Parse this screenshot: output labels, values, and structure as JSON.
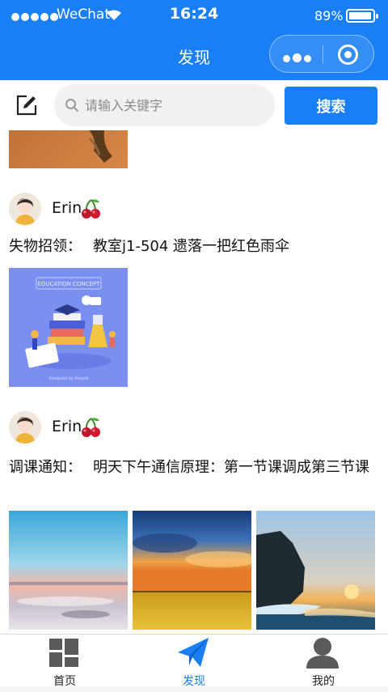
{
  "status_bar": {
    "carrier": "WeChat",
    "time": "16:24",
    "battery": "89%",
    "battery_level": 0.89
  },
  "nav": {
    "title": "发现"
  },
  "search": {
    "placeholder": "请输入关键字",
    "value": "",
    "button_label": "搜索"
  },
  "posts": [
    {
      "user": "Erin",
      "badge_icon": "cherry-icon",
      "type_label": "失物招领：",
      "content": "教室j1-504 遗落一把红色雨伞",
      "images": [
        "education-illustration"
      ]
    },
    {
      "user": "Erin",
      "badge_icon": "cherry-icon",
      "type_label": "调课通知：",
      "content": "明天下午通信原理：第一节课调成第三节课",
      "images": [
        "sunset-sea",
        "wheat-field-sky",
        "rock-coast-sunset"
      ]
    }
  ],
  "tabbar": [
    {
      "label": "首页",
      "icon": "grid-home-icon"
    },
    {
      "label": "发现",
      "icon": "paper-plane-icon",
      "active": true
    },
    {
      "label": "我的",
      "icon": "person-icon"
    }
  ],
  "colors": {
    "brand": "#1a7ff5",
    "search_bg": "#f1f1f1"
  }
}
